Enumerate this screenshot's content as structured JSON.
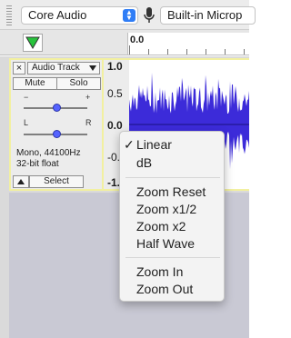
{
  "device_toolbar": {
    "host": "Core Audio",
    "input_device": "Built-in Microp",
    "icons": [
      "gripper-icon",
      "microphone-icon",
      "chevron-updown-icon"
    ]
  },
  "ruler": {
    "zero_label": "0.0"
  },
  "track": {
    "close_glyph": "×",
    "name": "Audio Track",
    "mute_label": "Mute",
    "solo_label": "Solo",
    "gain_minus": "−",
    "gain_plus": "+",
    "pan_left": "L",
    "pan_right": "R",
    "info_line1": "Mono, 44100Hz",
    "info_line2": "32-bit float",
    "select_label": "Select"
  },
  "scale": {
    "labels": [
      "1.0",
      "0.5",
      "0.0",
      "-0.",
      "-1."
    ]
  },
  "colors": {
    "waveform": "#3c2bd9",
    "selection_border": "#f2f0a0",
    "menu_bg": "#f3f3f3"
  },
  "menu": {
    "checkmark": "✓",
    "items": [
      "Linear",
      "dB",
      "Zoom Reset",
      "Zoom x1/2",
      "Zoom x2",
      "Half Wave",
      "Zoom In",
      "Zoom Out"
    ]
  }
}
